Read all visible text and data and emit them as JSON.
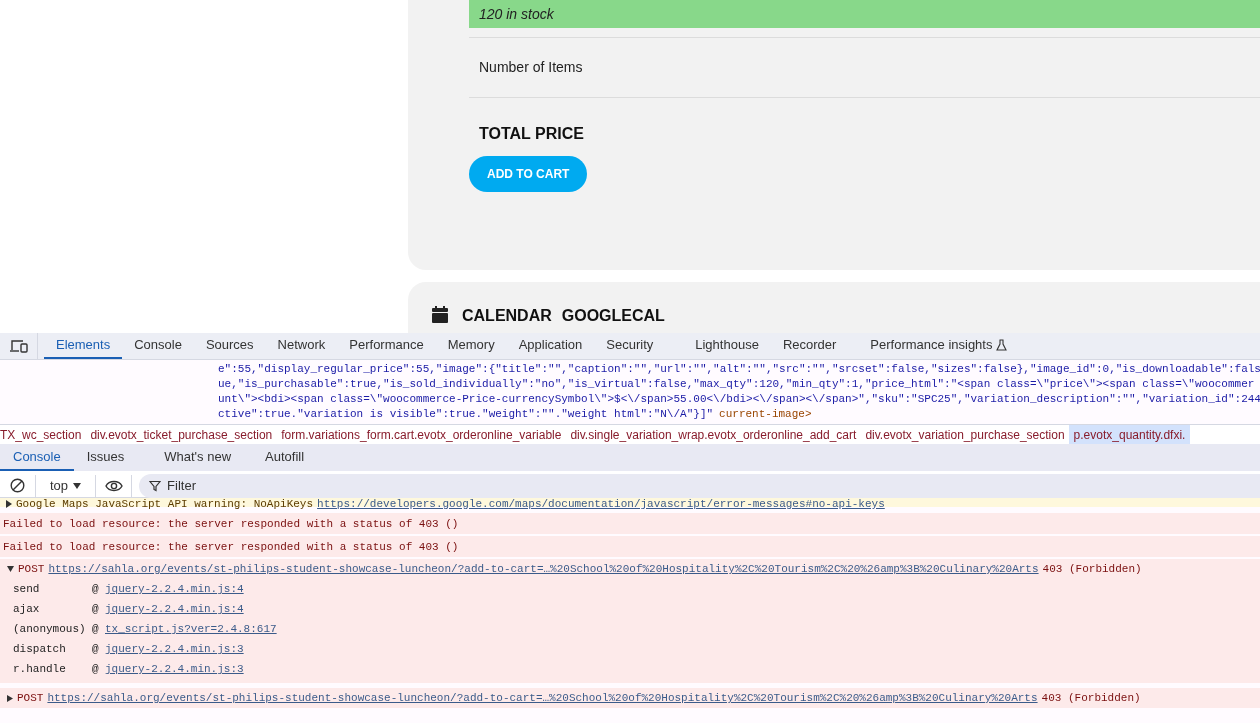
{
  "page": {
    "stock_notice": "120 in stock",
    "quantity_label": "Number of Items",
    "total_label": "TOTAL PRICE",
    "add_to_cart": "ADD TO CART",
    "calendar_heading": [
      "CALENDAR",
      "GOOGLECAL"
    ]
  },
  "devtools": {
    "tabs": [
      {
        "label": "Elements",
        "selected": true
      },
      {
        "label": "Console",
        "selected": false
      },
      {
        "label": "Sources",
        "selected": false
      },
      {
        "label": "Network",
        "selected": false
      },
      {
        "label": "Performance",
        "selected": false
      },
      {
        "label": "Memory",
        "selected": false
      },
      {
        "label": "Application",
        "selected": false
      },
      {
        "label": "Security",
        "selected": false
      },
      {
        "label": "Lighthouse",
        "selected": false
      },
      {
        "label": "Recorder",
        "selected": false
      },
      {
        "label": "Performance insights",
        "selected": false
      }
    ],
    "source_lines": [
      {
        "text": "e\":55,\"display_regular_price\":55,\"image\":{\"title\":\"\",\"caption\":\"\",\"url\":\"\",\"alt\":\"\",\"src\":\"\",\"srcset\":false,\"sizes\":false},\"image_id\":0,\"is_downloadable\":fals"
      },
      {
        "text": "ue,\"is_purchasable\":true,\"is_sold_individually\":\"no\",\"is_virtual\":false,\"max_qty\":120,\"min_qty\":1,\"price_html\":\"<span class=\\\"price\\\"><span class=\\\"woocommer"
      },
      {
        "text": "unt\\\"><bdi><span class=\\\"woocommerce-Price-currencySymbol\\\">$<\\/span>55.00<\\/bdi><\\/span><\\/span>\",\"sku\":\"SPC25\",\"variation_description\":\"\",\"variation_id\":244"
      },
      {
        "text": "ctive\":true.\"variation is visible\":true.\"weight\":\"\".\"weight html\":\"N\\/A\"}]\"",
        "attribute": "current-image>"
      }
    ],
    "breadcrumbs": [
      {
        "label": "TX_wc_section",
        "selected": false
      },
      {
        "label": "div.evotx_ticket_purchase_section",
        "selected": false
      },
      {
        "label": "form.variations_form.cart.evotx_orderonline_variable",
        "selected": false
      },
      {
        "label": "div.single_variation_wrap.evotx_orderonline_add_cart",
        "selected": false
      },
      {
        "label": "div.evotx_variation_purchase_section",
        "selected": false
      },
      {
        "label": "p.evotx_quantity.dfxi.",
        "selected": true
      }
    ],
    "drawer_tabs": [
      {
        "label": "Console",
        "selected": true
      },
      {
        "label": "Issues",
        "selected": false
      },
      {
        "label": "What's new",
        "selected": false
      },
      {
        "label": "Autofill",
        "selected": false
      }
    ],
    "console_toolbar": {
      "context": "top",
      "filter_placeholder": "Filter"
    },
    "messages": [
      {
        "kind": "warning",
        "text": "Google Maps JavaScript API warning: NoApiKeys",
        "url": "https://developers.google.com/maps/documentation/javascript/error-messages#no-api-keys"
      },
      {
        "kind": "error",
        "text": "Failed to load resource: the server responded with a status of 403 ()"
      },
      {
        "kind": "error",
        "text": "Failed to load resource: the server responded with a status of 403 ()"
      },
      {
        "kind": "request",
        "expanded": true,
        "method": "POST",
        "url": "https://sahla.org/events/st-philips-student-showcase-luncheon/?add-to-cart=…%20School%20of%20Hospitality%2C%20Tourism%2C%20%26amp%3B%20Culinary%20Arts",
        "status": "403 (Forbidden)",
        "stack": [
          {
            "function": "send",
            "at": "@",
            "location": "jquery-2.2.4.min.js:4"
          },
          {
            "function": "ajax",
            "at": "@",
            "location": "jquery-2.2.4.min.js:4"
          },
          {
            "function": "(anonymous)",
            "at": "@",
            "location": "tx_script.js?ver=2.4.8:617"
          },
          {
            "function": "dispatch",
            "at": "@",
            "location": "jquery-2.2.4.min.js:3"
          },
          {
            "function": "r.handle",
            "at": "@",
            "location": "jquery-2.2.4.min.js:3"
          }
        ]
      },
      {
        "kind": "request",
        "expanded": false,
        "method": "POST",
        "url": "https://sahla.org/events/st-philips-student-showcase-luncheon/?add-to-cart=…%20School%20of%20Hospitality%2C%20Tourism%2C%20%26amp%3B%20Culinary%20Arts",
        "status": "403 (Forbidden)"
      }
    ]
  }
}
